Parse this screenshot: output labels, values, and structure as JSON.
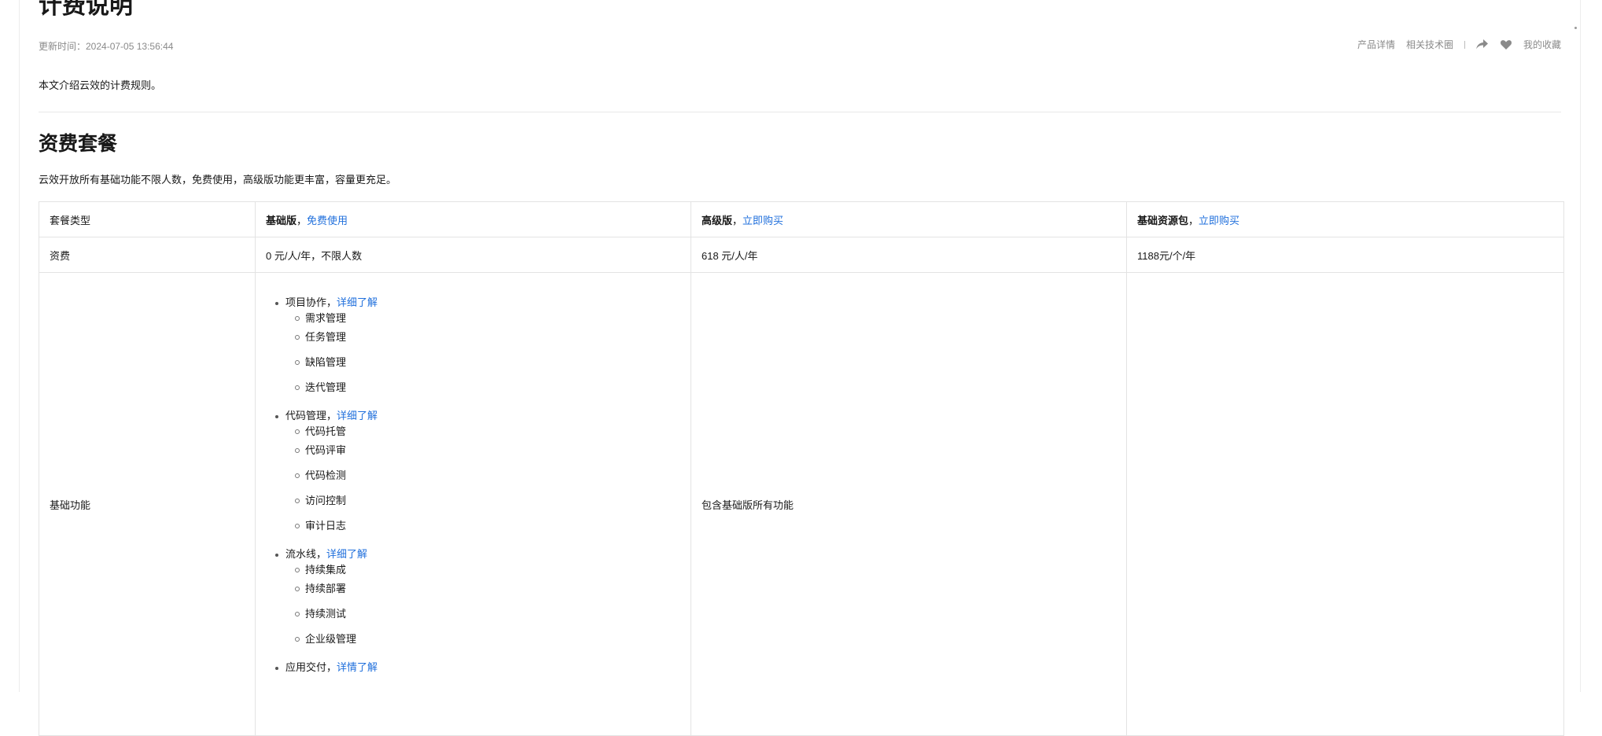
{
  "header": {
    "title": "计费说明",
    "updated": "更新时间：2024-07-05 13:56:44",
    "actions": {
      "product_detail": "产品详情",
      "tech_circle": "相关技术圈",
      "favorite": "我的收藏"
    }
  },
  "intro": "本文介绍云效的计费规则。",
  "section": {
    "title": "资费套餐",
    "desc": "云效开放所有基础功能不限人数，免费使用，高级版功能更丰富，容量更充足。"
  },
  "table": {
    "head": {
      "col0": "套餐类型",
      "basic_name": "基础版",
      "basic_link": "免费使用",
      "adv_name": "高级版",
      "adv_link": "立即购买",
      "pack_name": "基础资源包",
      "pack_link": "立即购买",
      "sep": "，"
    },
    "price": {
      "label": "资费",
      "basic": "0 元/人/年，不限人数",
      "adv": "618 元/人/年",
      "pack": "1188元/个/年"
    },
    "features": {
      "label": "基础功能",
      "adv": "包含基础版所有功能",
      "groups": [
        {
          "name": "项目协作，",
          "link": "详细了解",
          "items": [
            "需求管理",
            "任务管理",
            "缺陷管理",
            "迭代管理"
          ]
        },
        {
          "name": "代码管理，",
          "link": "详细了解",
          "items": [
            "代码托管",
            "代码评审",
            "代码检测",
            "访问控制",
            "审计日志"
          ]
        },
        {
          "name": "流水线，",
          "link": "详细了解",
          "items": [
            "持续集成",
            "持续部署",
            "持续测试",
            "企业级管理"
          ]
        },
        {
          "name": "应用交付，",
          "link": "详情了解",
          "items": []
        }
      ]
    }
  },
  "colors": {
    "link": "#1f6fdc",
    "text": "#181818",
    "muted": "#8a8a8a",
    "border": "#e3e3e3"
  }
}
